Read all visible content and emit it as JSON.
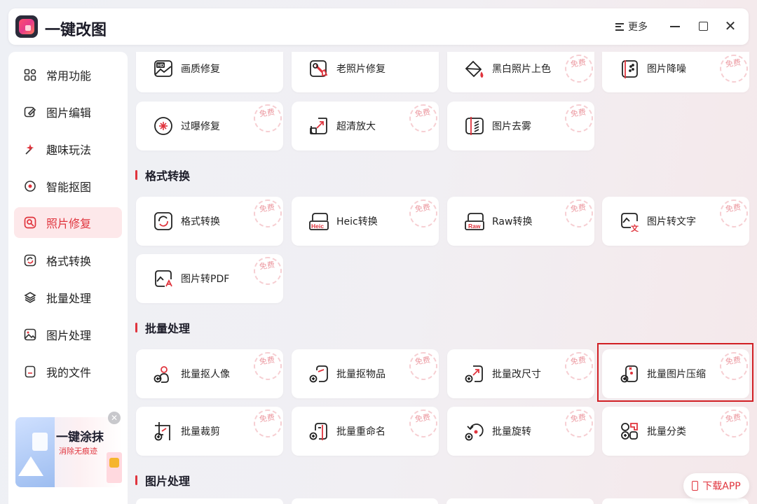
{
  "app": {
    "title": "一键改图",
    "more_label": "更多"
  },
  "sidebar": {
    "items": [
      {
        "label": "常用功能",
        "icon": "grid-icon"
      },
      {
        "label": "图片编辑",
        "icon": "edit-icon"
      },
      {
        "label": "趣味玩法",
        "icon": "magic-icon"
      },
      {
        "label": "智能抠图",
        "icon": "cutout-icon"
      },
      {
        "label": "照片修复",
        "icon": "repair-icon",
        "active": true
      },
      {
        "label": "格式转换",
        "icon": "convert-icon"
      },
      {
        "label": "批量处理",
        "icon": "layers-icon"
      },
      {
        "label": "图片处理",
        "icon": "image-icon"
      },
      {
        "label": "我的文件",
        "icon": "file-icon"
      }
    ],
    "promo": {
      "title": "一键涂抹",
      "subtitle": "消除无痕迹"
    }
  },
  "badge_label": "免费",
  "photo_repair": {
    "row1": [
      "画质修复",
      "老照片修复",
      "黑白照片上色",
      "图片降噪"
    ],
    "row2": [
      "过曝修复",
      "超清放大",
      "图片去雾"
    ]
  },
  "sections": {
    "format": {
      "title": "格式转换",
      "row1": [
        "格式转换",
        "Heic转换",
        "Raw转换",
        "图片转文字"
      ],
      "row2": [
        "图片转PDF"
      ]
    },
    "batch": {
      "title": "批量处理",
      "row1": [
        "批量抠人像",
        "批量抠物品",
        "批量改尺寸",
        "批量图片压缩"
      ],
      "row2": [
        "批量裁剪",
        "批量重命名",
        "批量旋转",
        "批量分类"
      ]
    },
    "image_process": {
      "title": "图片处理"
    }
  },
  "icon_text": {
    "hd": "HD",
    "heic": "Heic",
    "raw": "Raw",
    "wen": "文"
  },
  "download_label": "下载APP",
  "colors": {
    "accent": "#e0343d",
    "highlight": "#d11f24"
  }
}
